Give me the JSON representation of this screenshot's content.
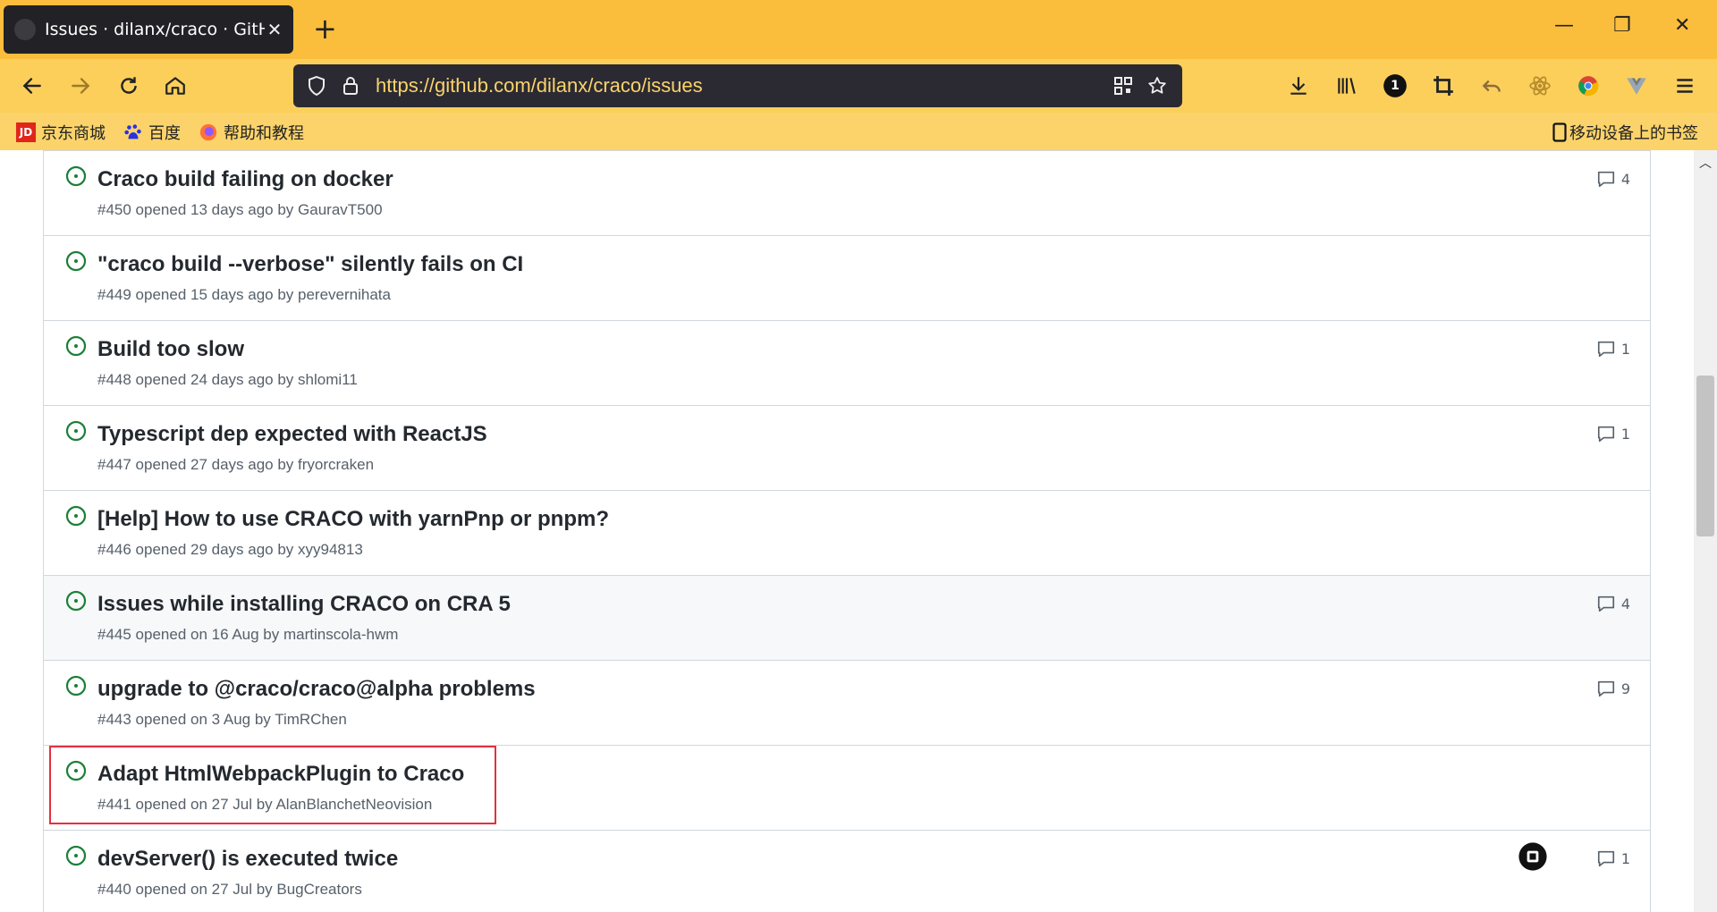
{
  "browser": {
    "tab_title": "Issues · dilanx/craco · GitHub",
    "tab_close": "✕",
    "new_tab": "+",
    "url": "https://github.com/dilanx/craco/issues",
    "window_controls": {
      "minimize": "—",
      "restore": "❐",
      "close": "✕"
    },
    "toolbar_icons": [
      "back-icon",
      "forward-icon",
      "reload-icon",
      "home-icon",
      "shield-icon",
      "lock-icon",
      "qr-code-icon",
      "bookmark-star-icon",
      "download-icon",
      "library-icon",
      "onepassword-icon",
      "crop-icon",
      "undo-icon",
      "react-devtools-icon",
      "chrome-icon",
      "vue-devtools-icon",
      "menu-icon"
    ],
    "onepassword_label": "1"
  },
  "bookmarks": {
    "items": [
      {
        "label": "京东商城",
        "icon": "jd-icon"
      },
      {
        "label": "百度",
        "icon": "baidu-icon"
      },
      {
        "label": "帮助和教程",
        "icon": "firefox-icon"
      }
    ],
    "mobile_label": "移动设备上的书签"
  },
  "issues": [
    {
      "title": "Craco build failing on docker",
      "meta": "#450 opened 13 days ago by GauravT500",
      "comments": "4"
    },
    {
      "title": "\"craco build --verbose\" silently fails on CI",
      "meta": "#449 opened 15 days ago by perevernihata",
      "comments": ""
    },
    {
      "title": "Build too slow",
      "meta": "#448 opened 24 days ago by shlomi11",
      "comments": "1"
    },
    {
      "title": "Typescript dep expected with ReactJS",
      "meta": "#447 opened 27 days ago by fryorcraken",
      "comments": "1"
    },
    {
      "title": "[Help] How to use CRACO with yarnPnp or pnpm?",
      "meta": "#446 opened 29 days ago by xyy94813",
      "comments": ""
    },
    {
      "title": "Issues while installing CRACO on CRA 5",
      "meta": "#445 opened on 16 Aug by martinscola-hwm",
      "comments": "4"
    },
    {
      "title": "upgrade to @craco/craco@alpha problems",
      "meta": "#443 opened on 3 Aug by TimRChen",
      "comments": "9"
    },
    {
      "title": "Adapt HtmlWebpackPlugin to Craco",
      "meta": "#441 opened on 27 Jul by AlanBlanchetNeovision",
      "comments": ""
    },
    {
      "title": "devServer() is executed twice",
      "meta": "#440 opened on 27 Jul by BugCreators",
      "comments": "1"
    }
  ],
  "colors": {
    "tabbar": "#fbbe3c",
    "navbar": "#fbcf5a",
    "open_issue_green": "#1a7f37",
    "highlight_red": "#e5303e"
  }
}
